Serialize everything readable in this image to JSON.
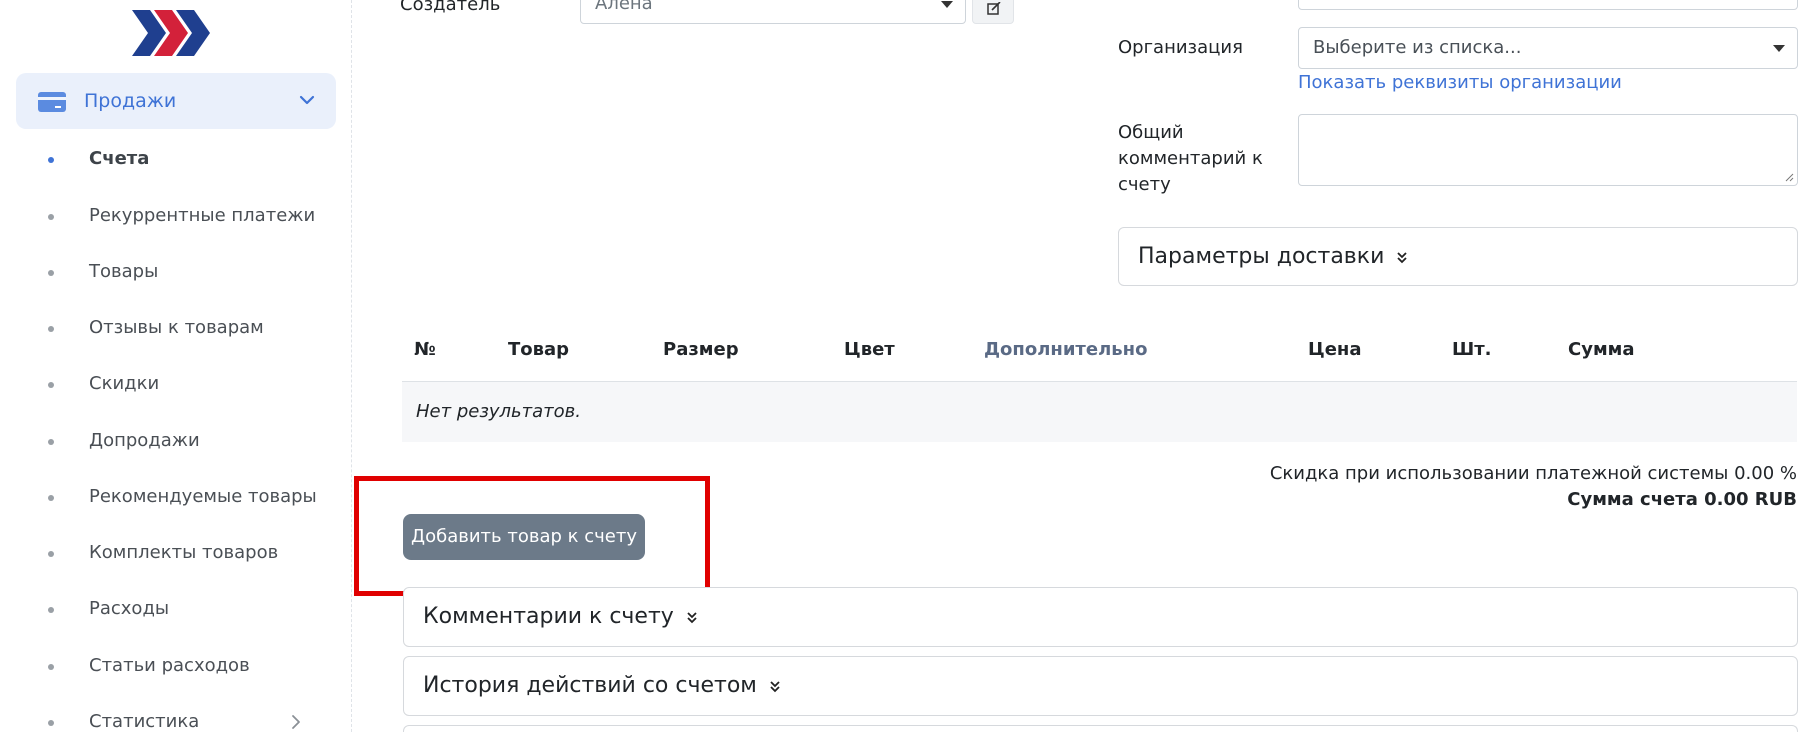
{
  "sidebar": {
    "section": {
      "label": "Продажи",
      "icon": "credit-card-icon"
    },
    "items": [
      {
        "label": "Счета",
        "active": true
      },
      {
        "label": "Рекуррентные платежи"
      },
      {
        "label": "Товары"
      },
      {
        "label": "Отзывы к товарам"
      },
      {
        "label": "Скидки"
      },
      {
        "label": "Допродажи"
      },
      {
        "label": "Рекомендуемые товары"
      },
      {
        "label": "Комплекты товаров"
      },
      {
        "label": "Расходы"
      },
      {
        "label": "Статьи расходов"
      },
      {
        "label": "Статистика",
        "has_submenu": true
      }
    ]
  },
  "form": {
    "creator_label": "Создатель",
    "creator_value": "Алена",
    "org_label": "Организация",
    "org_placeholder": "Выберите из списка...",
    "org_details_link": "Показать реквизиты организации",
    "comment_label_1": "Общий",
    "comment_label_2": "комментарий к",
    "comment_label_3": "счету",
    "delivery_params": "Параметры доставки"
  },
  "table": {
    "columns": [
      "№",
      "Товар",
      "Размер",
      "Цвет",
      "Дополнительно",
      "Цена",
      "Шт.",
      "Сумма"
    ],
    "empty_text": "Нет результатов."
  },
  "summary": {
    "discount": "Скидка при использовании платежной системы 0.00 %",
    "total": "Сумма счета 0.00 RUB"
  },
  "actions": {
    "add_product": "Добавить товар к счету"
  },
  "panels": {
    "comments": "Комментарии к счету",
    "history": "История действий со счетом"
  },
  "colors": {
    "accent": "#3f73d6",
    "highlight": "#e00000",
    "button": "#6c7a89"
  }
}
